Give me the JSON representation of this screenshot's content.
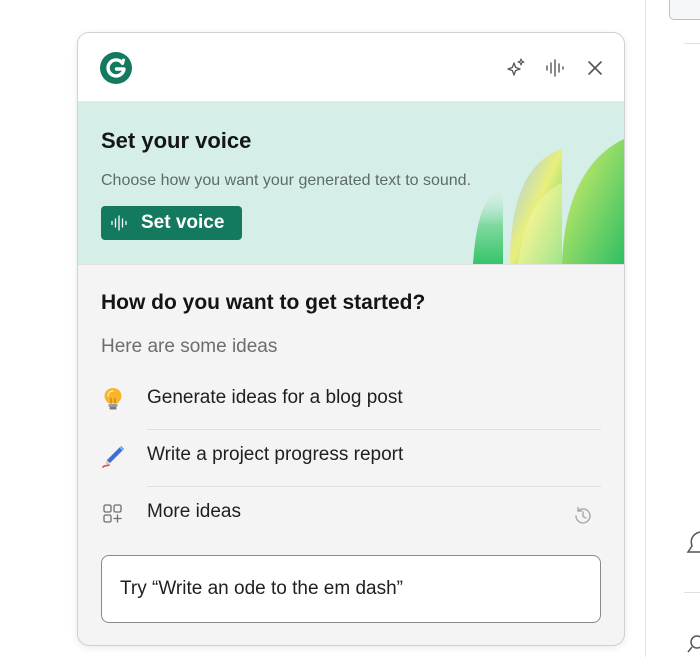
{
  "header": {
    "logo_icon": "grammarly-logo",
    "actions": [
      {
        "icon": "sparkle-icon"
      },
      {
        "icon": "voice-waveform-icon"
      },
      {
        "icon": "close-icon"
      }
    ]
  },
  "voice_banner": {
    "title": "Set your voice",
    "description": "Choose how you want your generated text to sound.",
    "button_label": "Set voice",
    "button_icon": "voice-waveform-icon"
  },
  "start": {
    "title": "How do you want to get started?",
    "subtitle": "Here are some ideas",
    "ideas": [
      {
        "label": "Generate ideas for a blog post",
        "icon": "lightbulb-icon"
      },
      {
        "label": "Write a project progress report",
        "icon": "pen-icon"
      },
      {
        "label": "More ideas",
        "icon": "grid-plus-icon"
      }
    ],
    "history_icon": "history-icon"
  },
  "prompt": {
    "placeholder": "Try “Write an ode to the em dash”"
  },
  "colors": {
    "brand_green": "#137a5f",
    "banner_bg": "#d5efe8",
    "panel_bg": "#f4f4f4"
  }
}
